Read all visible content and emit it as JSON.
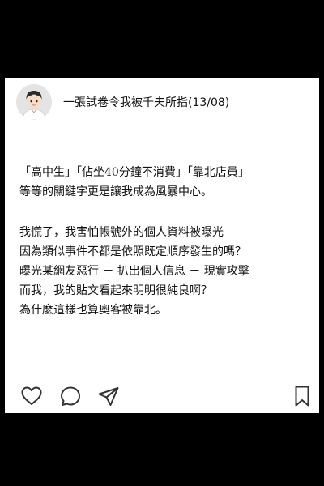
{
  "post": {
    "title": "一張試卷令我被千夫所指(13/08)",
    "lines_a": [
      "「高中生」「佔坐40分鐘不消費」「靠北店員」",
      "等等的關鍵字更是讓我成為風暴中心。"
    ],
    "lines_b": [
      "我慌了，我害怕帳號外的個人資料被曝光",
      "因為類似事件不都是依照既定順序發生的嗎？",
      "曝光某網友惡行 － 扒出個人信息 － 現實攻擊",
      "而我，我的貼文看起來明明很純良啊？",
      "為什麼這樣也算奧客被靠北。"
    ]
  },
  "icons": {
    "avatar": "user-avatar-icon",
    "like": "heart-icon",
    "comment": "comment-icon",
    "share": "send-icon",
    "save": "bookmark-icon"
  },
  "colors": {
    "background": "#000000",
    "card": "#ffffff",
    "text": "#111111",
    "divider": "#dcdcdc"
  }
}
